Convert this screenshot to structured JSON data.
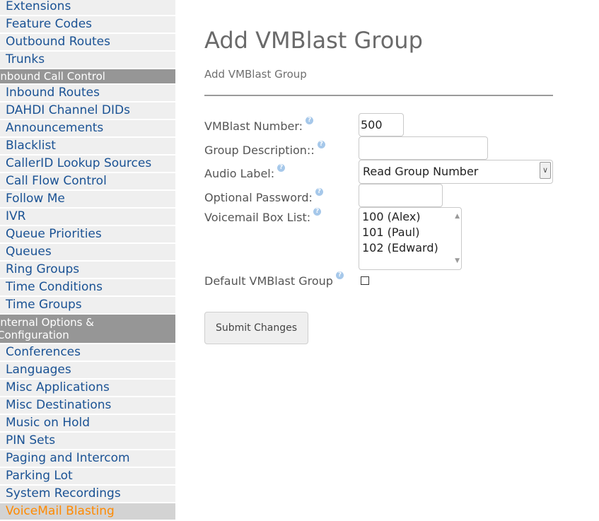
{
  "sidebar": {
    "items_top": [
      {
        "label": "Extensions"
      },
      {
        "label": "Feature Codes"
      },
      {
        "label": "Outbound Routes"
      },
      {
        "label": "Trunks"
      }
    ],
    "header1": "Inbound Call Control",
    "items_inbound": [
      {
        "label": "Inbound Routes"
      },
      {
        "label": "DAHDI Channel DIDs"
      },
      {
        "label": "Announcements"
      },
      {
        "label": "Blacklist"
      },
      {
        "label": "CallerID Lookup Sources"
      },
      {
        "label": "Call Flow Control"
      },
      {
        "label": "Follow Me"
      },
      {
        "label": "IVR"
      },
      {
        "label": "Queue Priorities"
      },
      {
        "label": "Queues"
      },
      {
        "label": "Ring Groups"
      },
      {
        "label": "Time Conditions"
      },
      {
        "label": "Time Groups"
      }
    ],
    "header2_line1": "Internal Options &",
    "header2_line2": "Configuration",
    "items_internal": [
      {
        "label": "Conferences"
      },
      {
        "label": "Languages"
      },
      {
        "label": "Misc Applications"
      },
      {
        "label": "Misc Destinations"
      },
      {
        "label": "Music on Hold"
      },
      {
        "label": "PIN Sets"
      },
      {
        "label": "Paging and Intercom"
      },
      {
        "label": "Parking Lot"
      },
      {
        "label": "System Recordings"
      }
    ],
    "active_item": "VoiceMail Blasting"
  },
  "page": {
    "title": "Add VMBlast Group",
    "subtitle": "Add VMBlast Group"
  },
  "form": {
    "vmblast_number_label": "VMBlast Number:",
    "vmblast_number_value": "500",
    "group_description_label": "Group Description::",
    "group_description_value": "",
    "audio_label_label": "Audio Label:",
    "audio_label_selected": "Read Group Number",
    "optional_password_label": "Optional Password:",
    "optional_password_value": "",
    "voicemail_box_list_label": "Voicemail Box List:",
    "voicemail_options": [
      "100 (Alex)",
      "101 (Paul)",
      "102 (Edward)"
    ],
    "default_group_label": "Default VMBlast Group",
    "default_group_checked": false,
    "submit_label": "Submit Changes",
    "help_glyph": "?"
  },
  "colors": {
    "nav_link": "#1a5294",
    "nav_active": "#ff8a00",
    "nav_header_bg": "#969696",
    "help_icon": "#a6c8ea"
  }
}
